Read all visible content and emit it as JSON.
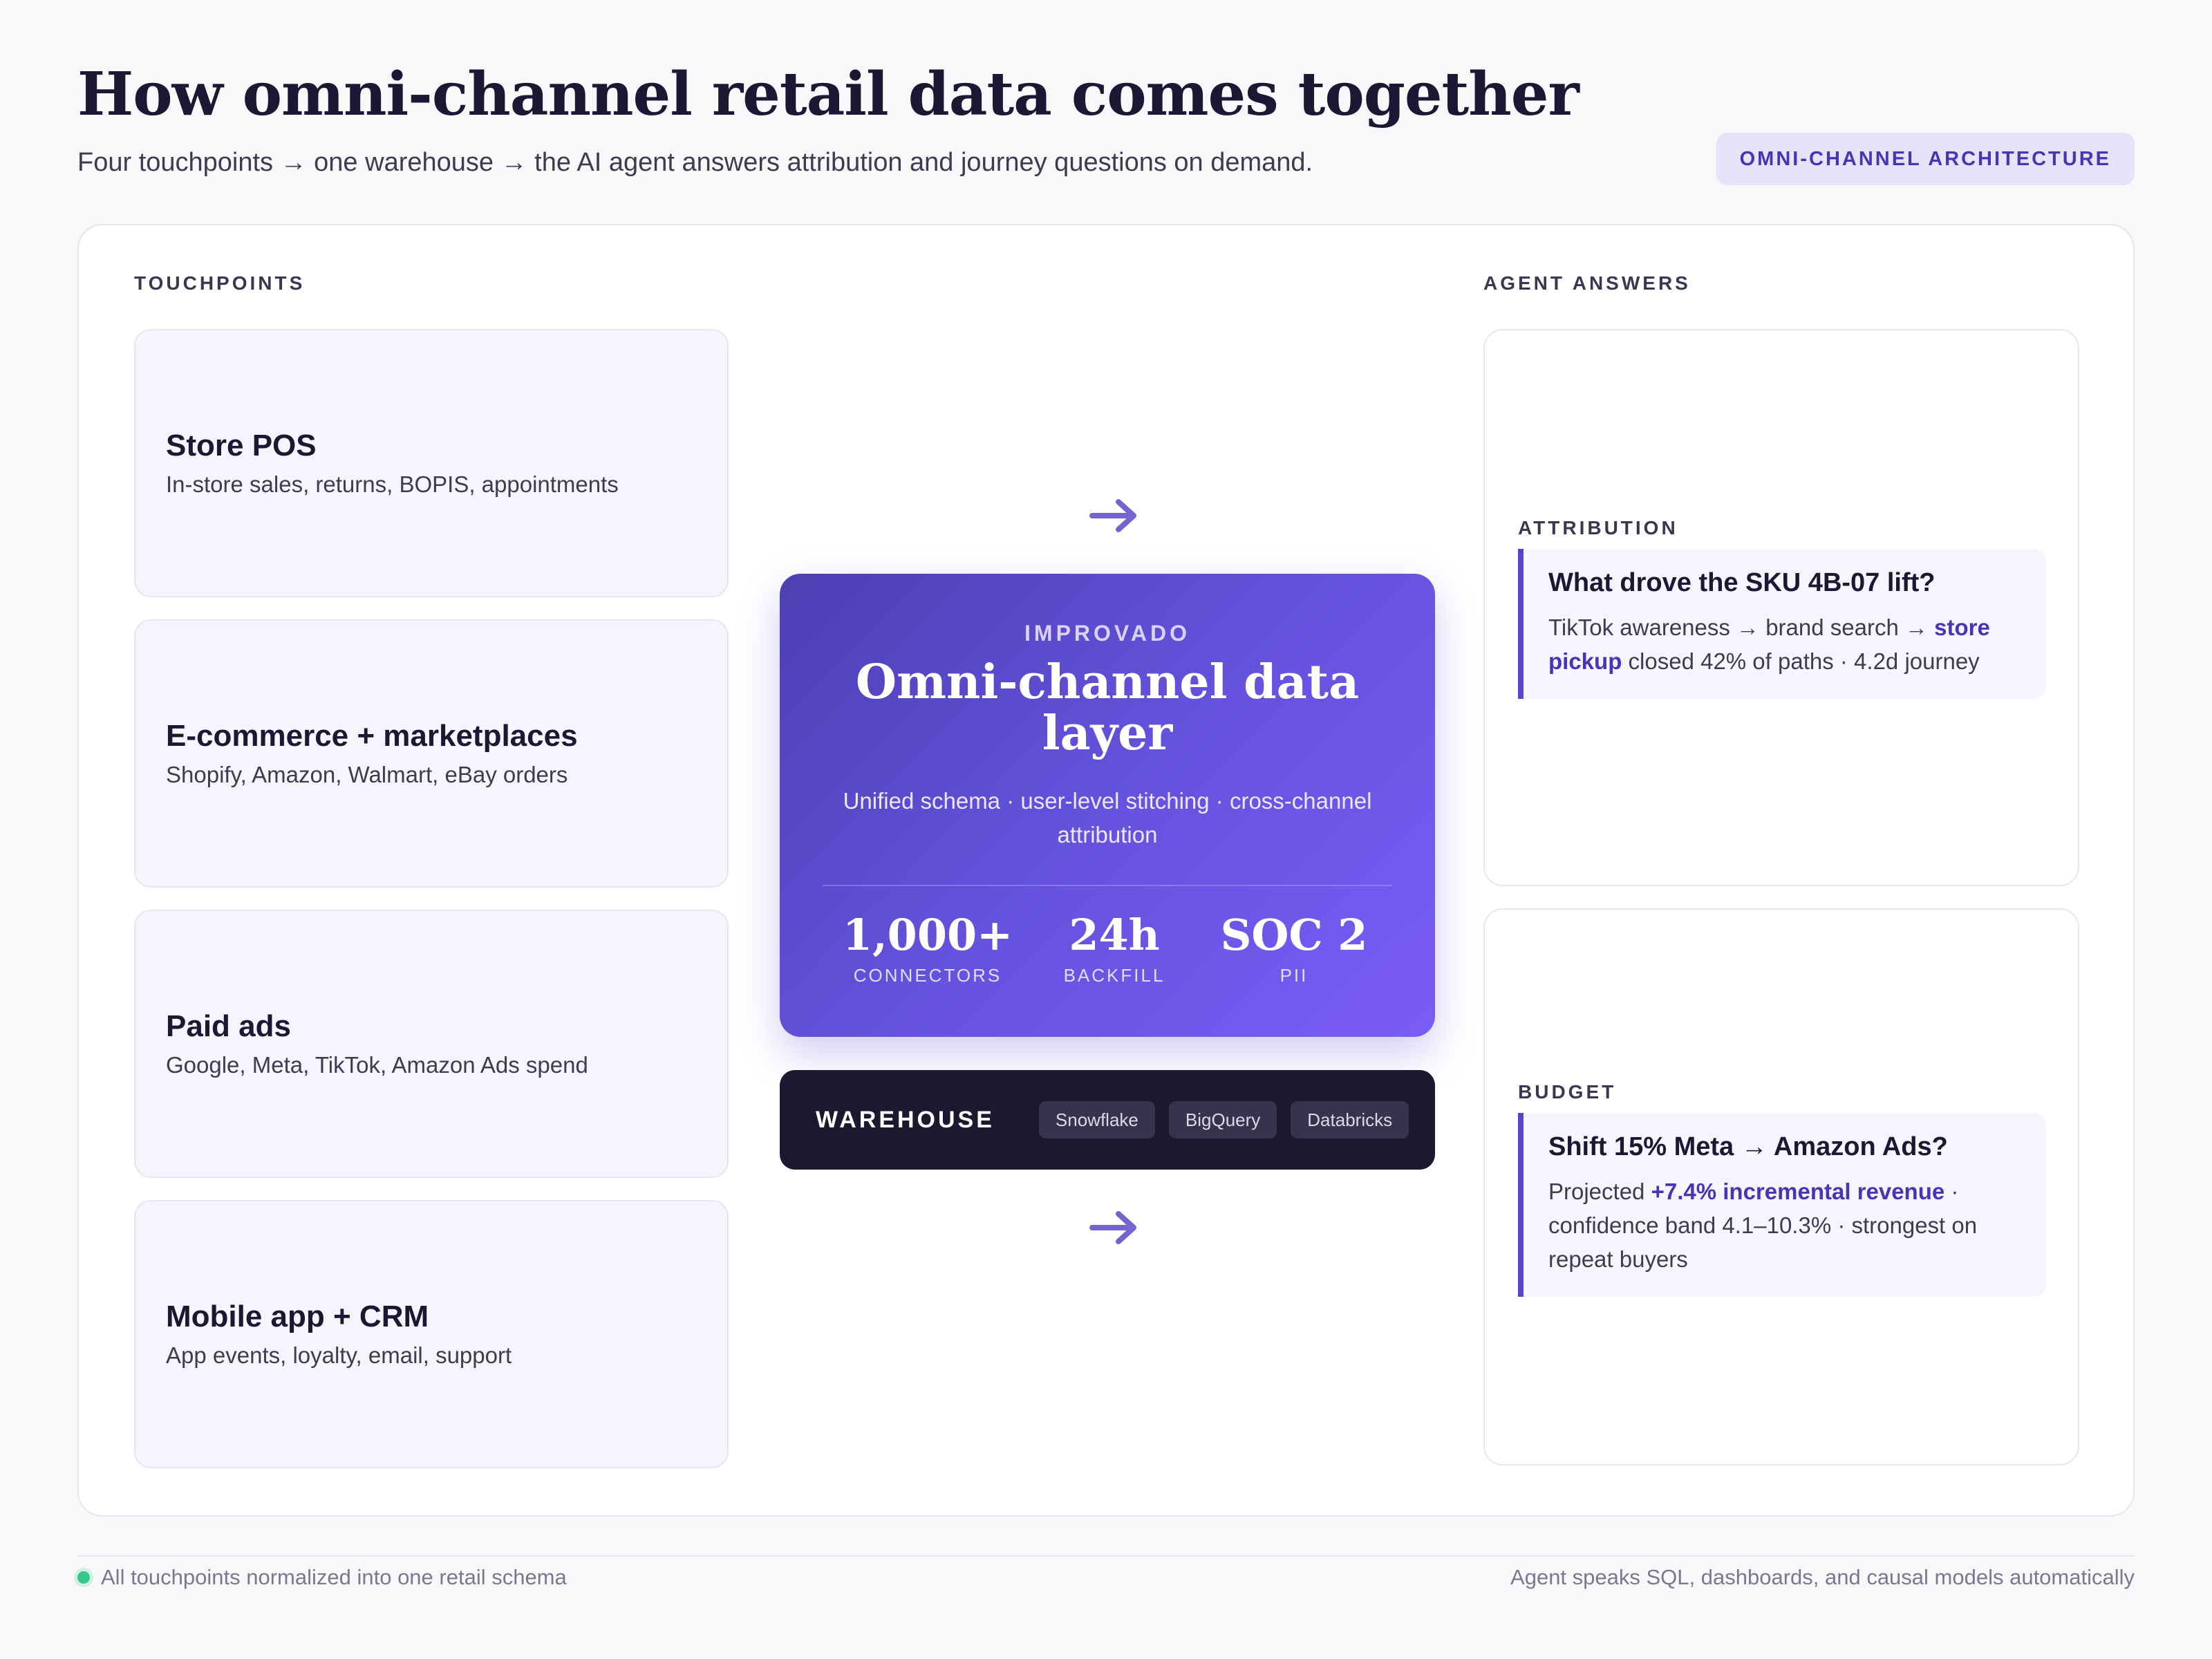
{
  "header": {
    "title": "How omni-channel retail data comes together",
    "subtitle": "Four touchpoints → one warehouse → the AI agent answers attribution and journey questions on demand.",
    "badge": "OMNI-CHANNEL ARCHITECTURE"
  },
  "touchpoints": {
    "label": "TOUCHPOINTS",
    "items": [
      {
        "title": "Store POS",
        "desc": "In-store sales, returns, BOPIS, appointments"
      },
      {
        "title": "E-commerce + marketplaces",
        "desc": "Shopify, Amazon, Walmart, eBay orders"
      },
      {
        "title": "Paid ads",
        "desc": "Google, Meta, TikTok, Amazon Ads spend"
      },
      {
        "title": "Mobile app + CRM",
        "desc": "App events, loyalty, email, support"
      }
    ]
  },
  "hub": {
    "eyebrow": "IMPROVADO",
    "title": "Omni-channel data layer",
    "desc": "Unified schema · user-level stitching · cross-channel attribution",
    "stats": [
      {
        "value": "1,000+",
        "label": "CONNECTORS"
      },
      {
        "value": "24h",
        "label": "BACKFILL"
      },
      {
        "value": "SOC 2",
        "label": "PII"
      }
    ]
  },
  "warehouse": {
    "label": "WAREHOUSE",
    "chips": [
      "Snowflake",
      "BigQuery",
      "Databricks"
    ]
  },
  "answers": {
    "label": "AGENT ANSWERS",
    "cards": [
      {
        "tag": "ATTRIBUTION",
        "question": "What drove the SKU 4B-07 lift?",
        "body_before": "TikTok awareness → brand search → ",
        "body_highlight": "store pickup",
        "body_after": " closed 42% of paths · 4.2d journey"
      },
      {
        "tag": "BUDGET",
        "question": "Shift 15% Meta → Amazon Ads?",
        "body_before": "Projected ",
        "body_highlight": "+7.4% incremental revenue",
        "body_after": " · confidence band 4.1–10.3% · strongest on repeat buyers"
      }
    ]
  },
  "footer": {
    "left": "All touchpoints normalized into one retail schema",
    "right": "Agent speaks SQL, dashboards, and causal models automatically"
  },
  "colors": {
    "accent": "#5a45c8",
    "hub_gradient_start": "#4d3fb3",
    "hub_gradient_end": "#7a5cf7",
    "warehouse_bg": "#1b1830",
    "status_dot": "#34c98a"
  },
  "icons": {
    "flow_arrow": "arrow-right-icon",
    "status": "status-dot-icon"
  }
}
